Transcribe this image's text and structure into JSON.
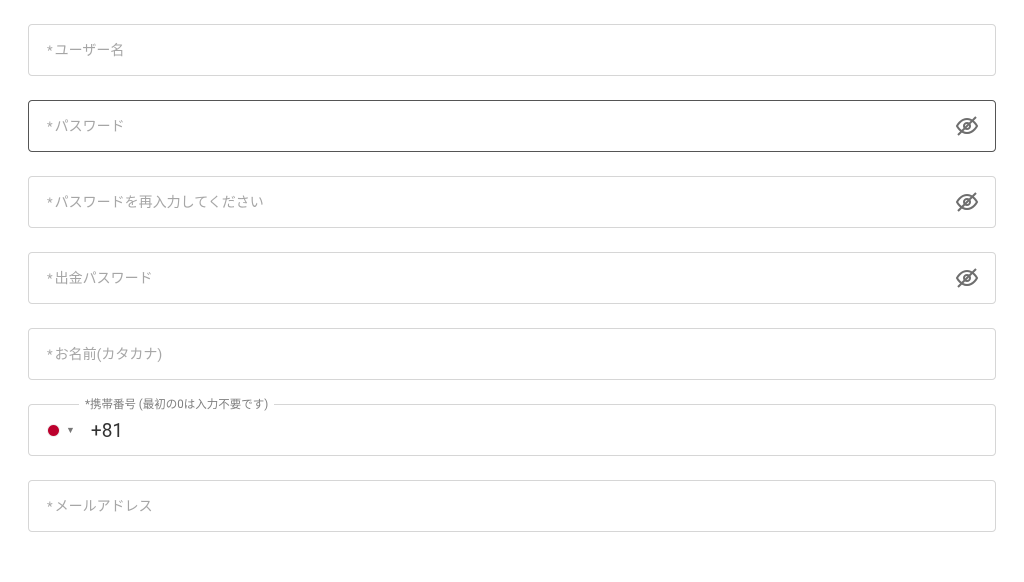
{
  "fields": {
    "username": {
      "placeholder": "ユーザー名"
    },
    "password": {
      "placeholder": "パスワード"
    },
    "password_confirm": {
      "placeholder": "パスワードを再入力してください"
    },
    "withdraw_password": {
      "placeholder": "出金パスワード"
    },
    "name_katakana": {
      "placeholder": "お名前(カタカナ)"
    },
    "phone": {
      "label": "*携帯番号 (最初の0は入力不要です)",
      "dial_code": "+81"
    },
    "email": {
      "placeholder": "メールアドレス"
    }
  }
}
